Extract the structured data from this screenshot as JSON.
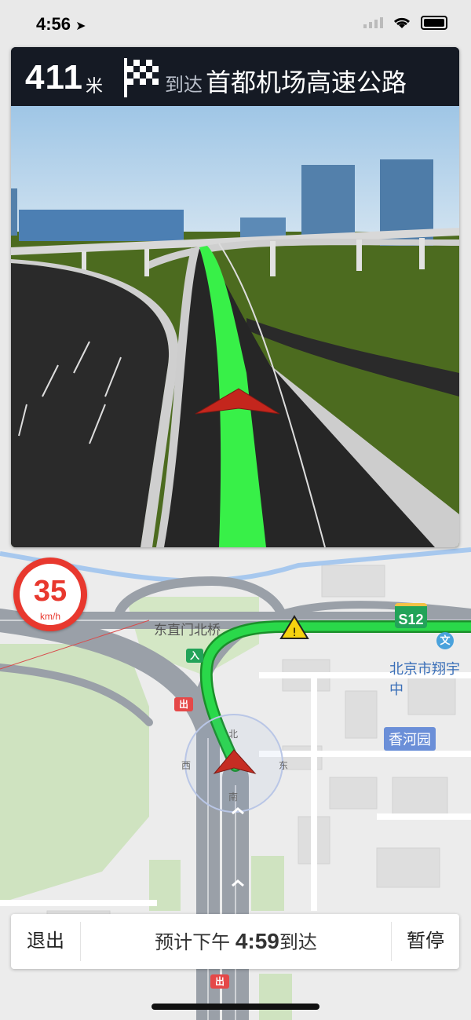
{
  "status_bar": {
    "time": "4:56"
  },
  "guidance": {
    "distance": "411",
    "distance_unit": "米",
    "arrive_label": "到达",
    "destination": "首都机场高速公路"
  },
  "speed_limit": {
    "value": "35",
    "unit": "km/h"
  },
  "map": {
    "bridge_label": "东直门北桥",
    "poi_1": "北京市翔宇中",
    "poi_2": "香河园",
    "highway_shield": "S12",
    "entrance_tag": "入",
    "exit_tag": "出",
    "compass": {
      "north": "北",
      "south": "南",
      "east": "东",
      "west": "西"
    }
  },
  "bottom_bar": {
    "exit_label": "退出",
    "eta_prefix": "预计下午",
    "eta_time": "4:59",
    "eta_suffix": "到达",
    "pause_label": "暂停"
  },
  "colors": {
    "route": "#1ec63b",
    "speed_red": "#e8382e",
    "header_bg": "#151a24",
    "shield_green": "#22a358"
  }
}
